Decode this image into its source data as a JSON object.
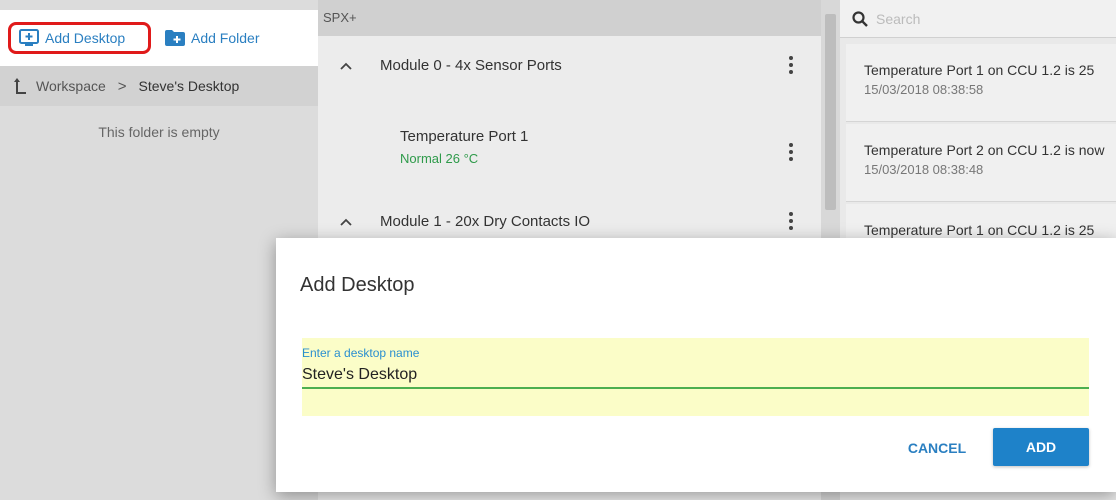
{
  "toolbar": {
    "add_desktop_label": "Add Desktop",
    "add_folder_label": "Add Folder",
    "add_desktop_icon": "desktop-plus-icon",
    "add_folder_icon": "folder-plus-icon",
    "highlight_color": "#e01a1a"
  },
  "breadcrumb": {
    "root_icon": "up-arrow-icon",
    "root": "Workspace",
    "separator": ">",
    "current": "Steve's Desktop"
  },
  "left_panel": {
    "empty_message": "This folder is empty"
  },
  "middle_panel": {
    "header": "SPX+",
    "modules": [
      {
        "label": "Module 0 - 4x Sensor Ports",
        "expanded": true
      },
      {
        "label": "Module 1 - 20x Dry Contacts IO",
        "expanded": true
      }
    ],
    "sensors": [
      {
        "name": "Temperature Port 1",
        "status": "Normal 26 °C",
        "status_color": "#2e9a4a"
      }
    ]
  },
  "right_panel": {
    "search_placeholder": "Search",
    "notifications": [
      {
        "message": "Temperature Port 1 on CCU 1.2 is 25",
        "time": "15/03/2018 08:38:58"
      },
      {
        "message": "Temperature Port 2 on CCU 1.2 is now",
        "time": "15/03/2018 08:38:48"
      },
      {
        "message": "Temperature Port 1 on CCU 1.2 is 25",
        "time": ""
      }
    ]
  },
  "dialog": {
    "title": "Add Desktop",
    "field_label": "Enter a desktop name",
    "field_value": "Steve's Desktop",
    "cancel_label": "CANCEL",
    "add_label": "ADD",
    "field_bg": "#fbfdc8",
    "accent": "#1e82c9"
  }
}
